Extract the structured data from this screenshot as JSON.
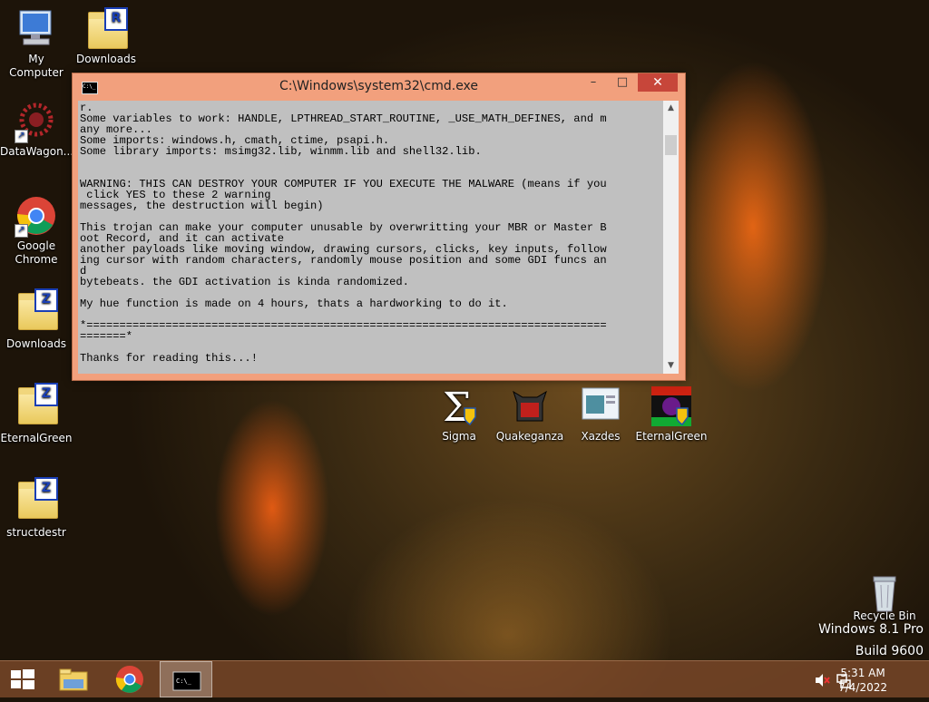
{
  "desktop": {
    "icons": [
      {
        "label": "My Computer"
      },
      {
        "label": "Downloads",
        "badge": "R"
      },
      {
        "label": "DataWagon..."
      },
      {
        "label": "Google Chrome"
      },
      {
        "label": "Downloads",
        "badge": "Z"
      },
      {
        "label": "EternalGreen",
        "badge": "Z"
      },
      {
        "label": "structdestr",
        "badge": "Z"
      },
      {
        "label": "Sigma"
      },
      {
        "label": "Quakeganza"
      },
      {
        "label": "Xazdes"
      },
      {
        "label": "EternalGreen"
      },
      {
        "label": "Recycle Bin"
      }
    ]
  },
  "cmd": {
    "title": "C:\\Windows\\system32\\cmd.exe",
    "minimize": "–",
    "maximize": "□",
    "close": "✕",
    "output": "r.\nSome variables to work: HANDLE, LPTHREAD_START_ROUTINE, _USE_MATH_DEFINES, and m\nany more...\nSome imports: windows.h, cmath, ctime, psapi.h.\nSome library imports: msimg32.lib, winmm.lib and shell32.lib.\n\n\nWARNING: THIS CAN DESTROY YOUR COMPUTER IF YOU EXECUTE THE MALWARE (means if you\n click YES to these 2 warning\nmessages, the destruction will begin)\n\nThis trojan can make your computer unusable by overwritting your MBR or Master B\noot Record, and it can activate\nanother payloads like moving window, drawing cursors, clicks, key inputs, follow\ning cursor with random characters, randomly mouse position and some GDI funcs an\nd\nbytebeats. the GDI activation is kinda randomized.\n\nMy hue function is made on 4 hours, thats a hardworking to do it.\n\n*===============================================================================\n=======*\n\nThanks for reading this...!\n\n_"
  },
  "watermark": {
    "line1": "Windows 8.1 Pro",
    "line2": "Build 9600"
  },
  "taskbar": {
    "time": "5:31 AM",
    "date": "7/4/2022"
  },
  "colors": {
    "accent": "#f2a07d",
    "close": "#c7463a"
  }
}
